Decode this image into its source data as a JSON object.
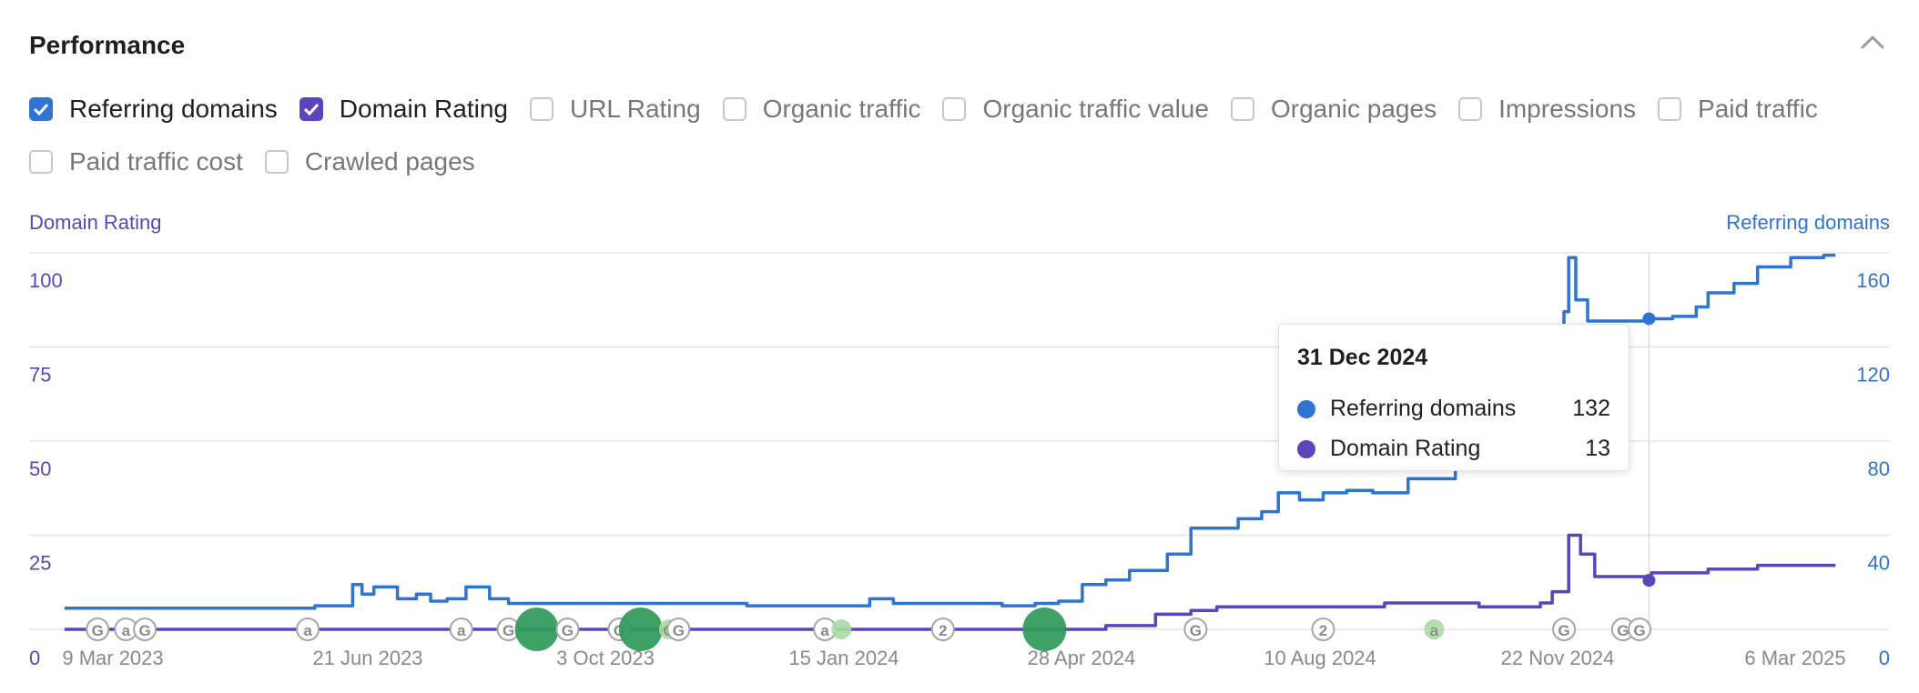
{
  "header": {
    "title": "Performance",
    "collapse_icon": "chevron-up-icon"
  },
  "metrics": [
    {
      "label": "Referring domains",
      "checked": true,
      "color": "#2f74d0"
    },
    {
      "label": "Domain Rating",
      "checked": true,
      "color": "#5b45b8"
    },
    {
      "label": "URL Rating",
      "checked": false
    },
    {
      "label": "Organic traffic",
      "checked": false
    },
    {
      "label": "Organic traffic value",
      "checked": false
    },
    {
      "label": "Organic pages",
      "checked": false
    },
    {
      "label": "Impressions",
      "checked": false
    },
    {
      "label": "Paid traffic",
      "checked": false
    },
    {
      "label": "Paid traffic cost",
      "checked": false
    },
    {
      "label": "Crawled pages",
      "checked": false
    }
  ],
  "tooltip": {
    "date": "31 Dec 2024",
    "rows": [
      {
        "label": "Referring domains",
        "value": "132",
        "color": "#2f74d0"
      },
      {
        "label": "Domain Rating",
        "value": "13",
        "color": "#5b45b8"
      }
    ]
  },
  "chart_data": {
    "type": "line",
    "x_range": [
      "2023-02-14",
      "2025-04-12"
    ],
    "x_ticks": [
      "9 Mar 2023",
      "21 Jun 2023",
      "3 Oct 2023",
      "15 Jan 2024",
      "28 Apr 2024",
      "10 Aug 2024",
      "22 Nov 2024",
      "6 Mar 2025"
    ],
    "y_left": {
      "label": "Domain Rating",
      "ticks": [
        "0",
        "25",
        "50",
        "75",
        "100"
      ],
      "range": [
        0,
        100
      ],
      "color": "#5b45b8"
    },
    "y_right": {
      "label": "Referring domains",
      "ticks": [
        "0",
        "40",
        "80",
        "120",
        "160"
      ],
      "range": [
        0,
        160
      ],
      "color": "#2f74d0"
    },
    "grid": true,
    "legend": "checkbox-row-top",
    "series": [
      {
        "name": "Referring domains",
        "axis": "right",
        "color": "#2f74d0",
        "points": [
          [
            "2023-03-01",
            9
          ],
          [
            "2023-05-20",
            9
          ],
          [
            "2023-06-15",
            10
          ],
          [
            "2023-06-25",
            10
          ],
          [
            "2023-07-01",
            19
          ],
          [
            "2023-07-05",
            15
          ],
          [
            "2023-07-10",
            18
          ],
          [
            "2023-07-20",
            13
          ],
          [
            "2023-07-28",
            15
          ],
          [
            "2023-08-03",
            12
          ],
          [
            "2023-08-10",
            13
          ],
          [
            "2023-08-18",
            18
          ],
          [
            "2023-08-28",
            13
          ],
          [
            "2023-09-05",
            11
          ],
          [
            "2023-12-01",
            11
          ],
          [
            "2023-12-15",
            10
          ],
          [
            "2024-01-31",
            10
          ],
          [
            "2024-02-05",
            13
          ],
          [
            "2024-02-15",
            11
          ],
          [
            "2024-04-01",
            10
          ],
          [
            "2024-04-15",
            11
          ],
          [
            "2024-04-25",
            12
          ],
          [
            "2024-05-05",
            19
          ],
          [
            "2024-05-15",
            21
          ],
          [
            "2024-05-25",
            25
          ],
          [
            "2024-06-10",
            32
          ],
          [
            "2024-06-20",
            43
          ],
          [
            "2024-07-10",
            47
          ],
          [
            "2024-07-20",
            50
          ],
          [
            "2024-07-27",
            58
          ],
          [
            "2024-08-05",
            55
          ],
          [
            "2024-08-15",
            58
          ],
          [
            "2024-08-25",
            59
          ],
          [
            "2024-09-05",
            58
          ],
          [
            "2024-09-20",
            64
          ],
          [
            "2024-10-10",
            68
          ],
          [
            "2024-10-25",
            70
          ],
          [
            "2024-11-10",
            74
          ],
          [
            "2024-11-20",
            78
          ],
          [
            "2024-11-25",
            135
          ],
          [
            "2024-11-27",
            158
          ],
          [
            "2024-11-30",
            140
          ],
          [
            "2024-12-05",
            131
          ],
          [
            "2024-12-15",
            131
          ],
          [
            "2024-12-31",
            132
          ],
          [
            "2025-01-10",
            133
          ],
          [
            "2025-01-20",
            137
          ],
          [
            "2025-01-25",
            143
          ],
          [
            "2025-02-05",
            147
          ],
          [
            "2025-02-15",
            154
          ],
          [
            "2025-03-01",
            158
          ],
          [
            "2025-03-10",
            158
          ],
          [
            "2025-03-15",
            159
          ],
          [
            "2025-03-20",
            159
          ]
        ]
      },
      {
        "name": "Domain Rating",
        "axis": "left",
        "color": "#5b45b8",
        "points": [
          [
            "2023-03-01",
            0
          ],
          [
            "2024-05-10",
            0
          ],
          [
            "2024-05-15",
            1
          ],
          [
            "2024-06-01",
            1
          ],
          [
            "2024-06-05",
            4
          ],
          [
            "2024-06-20",
            5
          ],
          [
            "2024-07-01",
            6
          ],
          [
            "2024-08-15",
            6
          ],
          [
            "2024-09-10",
            7
          ],
          [
            "2024-10-15",
            7
          ],
          [
            "2024-10-20",
            6
          ],
          [
            "2024-11-15",
            7
          ],
          [
            "2024-11-20",
            10
          ],
          [
            "2024-11-27",
            25
          ],
          [
            "2024-12-02",
            20
          ],
          [
            "2024-12-08",
            14
          ],
          [
            "2024-12-31",
            13
          ],
          [
            "2025-01-01",
            15
          ],
          [
            "2025-01-25",
            16
          ],
          [
            "2025-02-15",
            17
          ],
          [
            "2025-03-20",
            17
          ]
        ]
      }
    ],
    "annotations": [
      {
        "date": "2023-03-15",
        "label": "G",
        "kind": "icon"
      },
      {
        "date": "2023-03-27",
        "label": "a",
        "kind": "icon"
      },
      {
        "date": "2023-04-04",
        "label": "G",
        "kind": "icon"
      },
      {
        "date": "2023-06-12",
        "label": "a",
        "kind": "icon"
      },
      {
        "date": "2023-08-16",
        "label": "a",
        "kind": "icon"
      },
      {
        "date": "2023-09-05",
        "label": "G",
        "kind": "icon"
      },
      {
        "date": "2023-09-17",
        "label": "",
        "kind": "big"
      },
      {
        "date": "2023-09-30",
        "label": "G",
        "kind": "icon"
      },
      {
        "date": "2023-10-22",
        "label": "G",
        "kind": "icon"
      },
      {
        "date": "2023-10-31",
        "label": "",
        "kind": "big"
      },
      {
        "date": "2023-11-12",
        "label": "G",
        "kind": "small"
      },
      {
        "date": "2023-11-16",
        "label": "G",
        "kind": "icon"
      },
      {
        "date": "2024-01-17",
        "label": "a",
        "kind": "icon"
      },
      {
        "date": "2024-01-24",
        "label": "",
        "kind": "small"
      },
      {
        "date": "2024-03-07",
        "label": "2",
        "kind": "icon"
      },
      {
        "date": "2024-04-19",
        "label": "",
        "kind": "big"
      },
      {
        "date": "2024-06-22",
        "label": "G",
        "kind": "icon"
      },
      {
        "date": "2024-08-15",
        "label": "2",
        "kind": "icon"
      },
      {
        "date": "2024-10-01",
        "label": "a",
        "kind": "small"
      },
      {
        "date": "2024-11-25",
        "label": "G",
        "kind": "icon"
      },
      {
        "date": "2024-12-20",
        "label": "G",
        "kind": "icon"
      },
      {
        "date": "2024-12-27",
        "label": "G",
        "kind": "icon"
      }
    ],
    "crosshair_date": "2024-12-31"
  }
}
